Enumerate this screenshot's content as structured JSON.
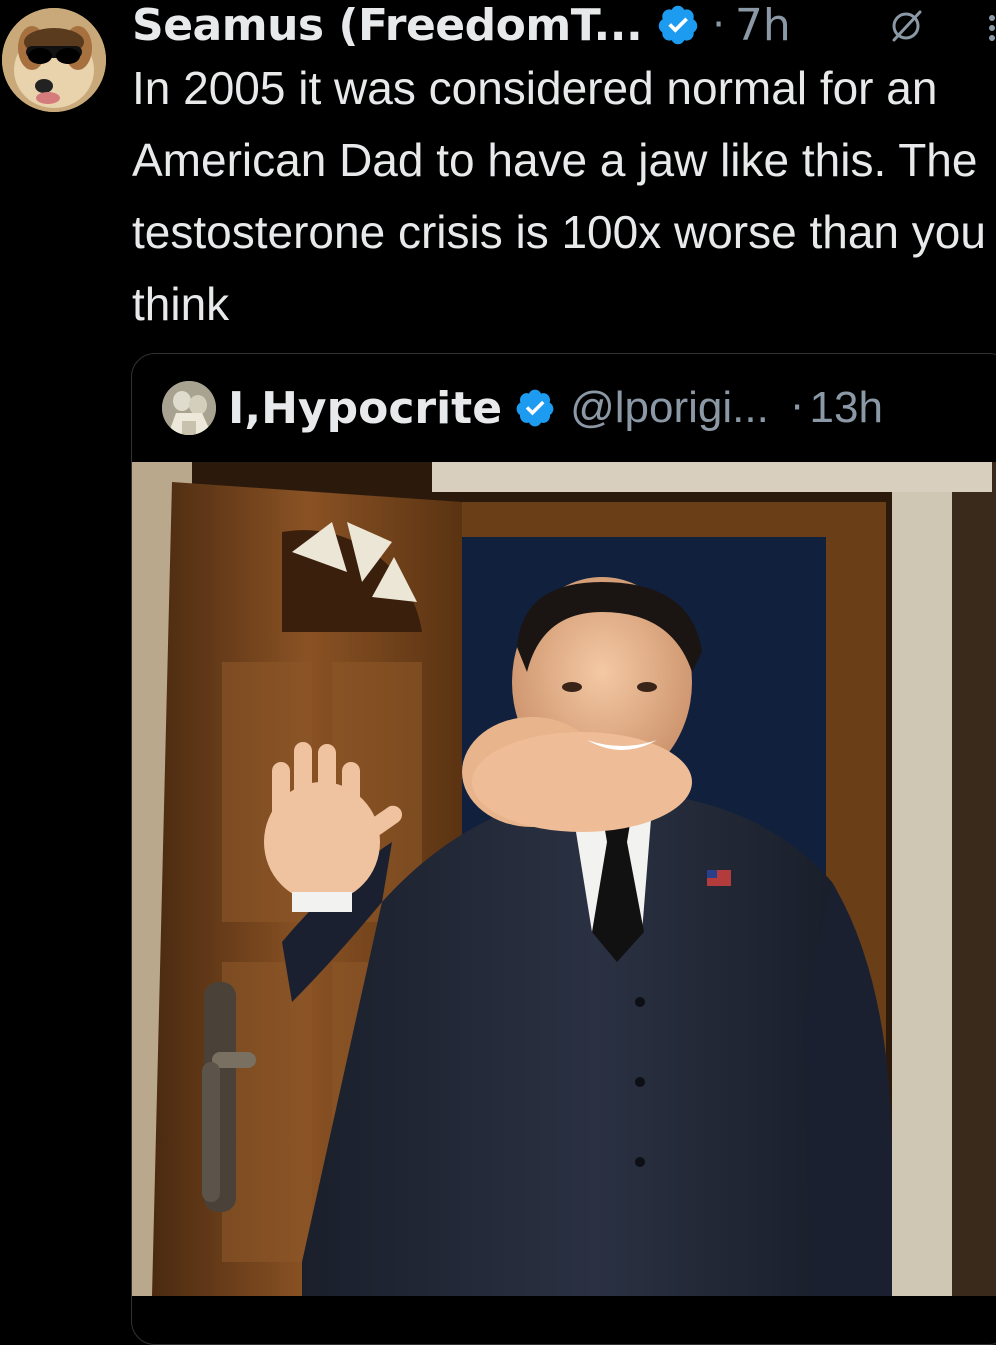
{
  "tweet": {
    "author": {
      "display_name": "Seamus (FreedomT...",
      "avatar_icon": "dog-with-sunglasses-avatar",
      "verified_icon": "verified-badge-icon"
    },
    "separator": "·",
    "timestamp": "7h",
    "grok_icon": "grok-icon",
    "more_icon": "more-options-icon",
    "text": "In 2005 it was considered normal for an American Dad to have a jaw like this. The testosterone crisis is 100x worse than you think"
  },
  "quoted_tweet": {
    "author": {
      "display_name": "I,Hypocrite",
      "handle": "@lporigi...",
      "avatar_icon": "statue-avatar",
      "verified_icon": "verified-badge-icon"
    },
    "separator": "·",
    "timestamp": "13h",
    "media_description_icon": "photo-man-in-suit-waving-at-door"
  },
  "colors": {
    "background": "#000000",
    "text_primary": "#e7e9ea",
    "text_secondary": "#8b98a5",
    "verified_blue": "#1d9bf0",
    "border": "#2f3336"
  }
}
